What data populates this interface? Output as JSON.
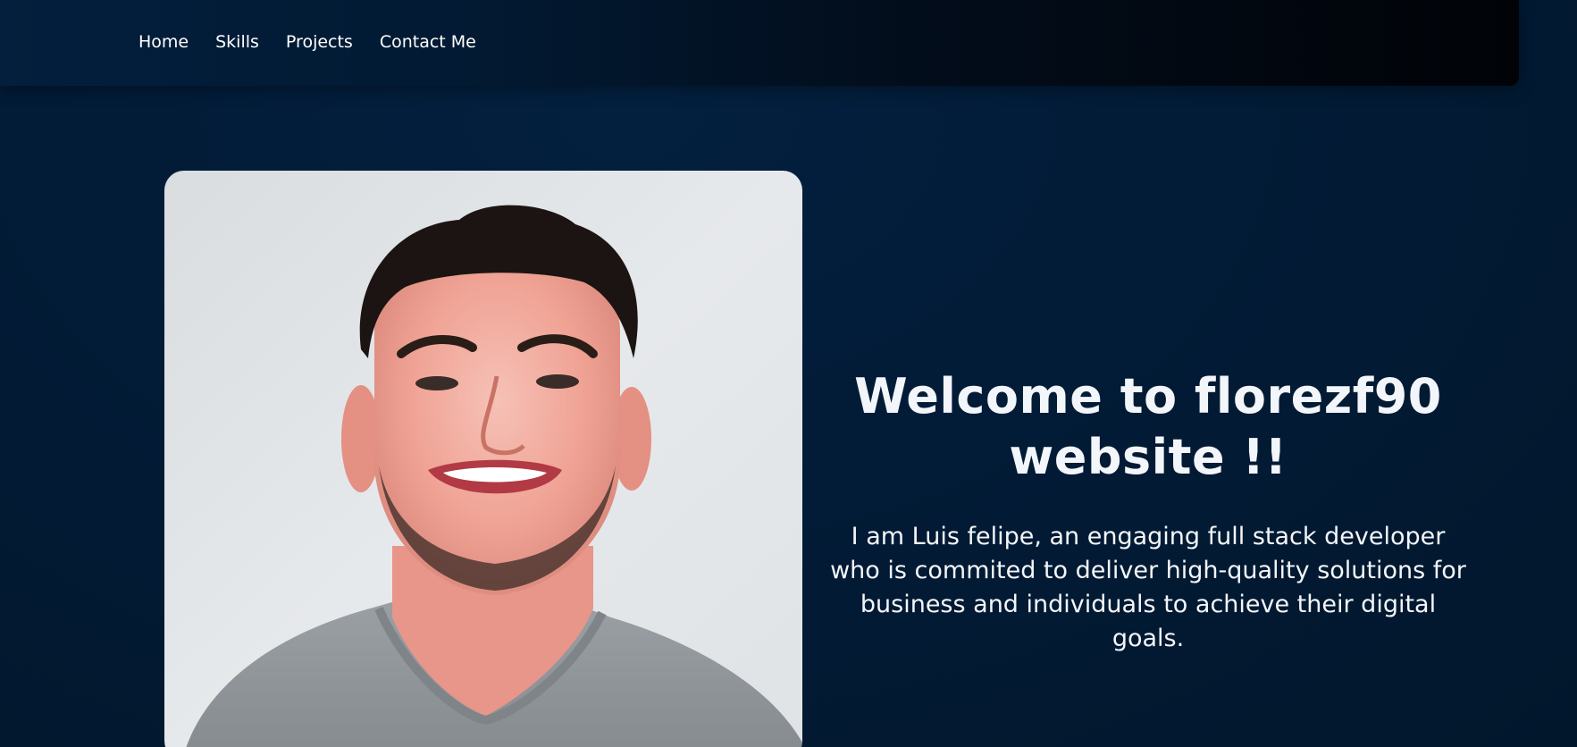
{
  "nav": {
    "items": [
      {
        "label": "Home"
      },
      {
        "label": "Skills"
      },
      {
        "label": "Projects"
      },
      {
        "label": "Contact Me"
      }
    ]
  },
  "hero": {
    "title_line1": "Welcome to florezf90",
    "title_line2": "website !!",
    "description": "I am Luis felipe, an engaging full stack developer who is commited to deliver high-quality solutions for business and individuals to achieve their digital goals."
  },
  "colors": {
    "background": "#021b36",
    "text": "#f2f6fa"
  }
}
